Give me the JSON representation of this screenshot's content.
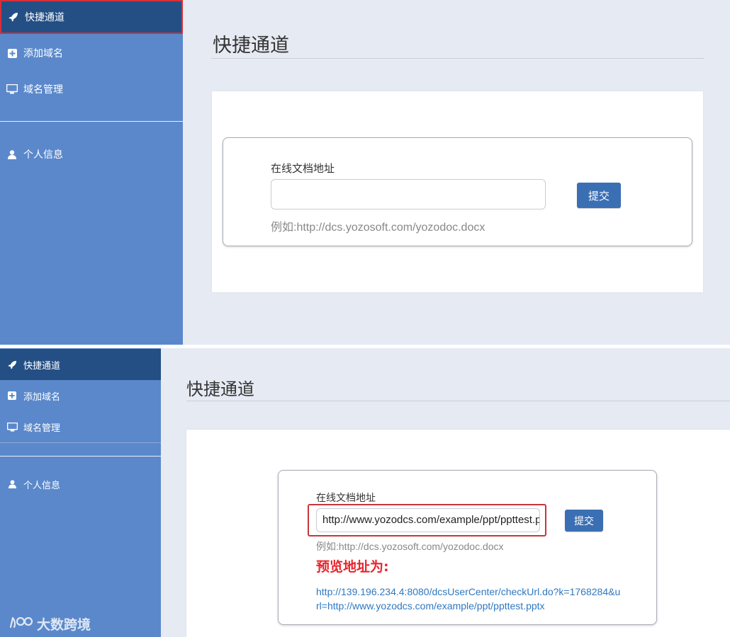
{
  "sidebar": {
    "items": [
      {
        "label": "快捷通道",
        "icon": "rocket-icon"
      },
      {
        "label": "添加域名",
        "icon": "plus-square-icon"
      },
      {
        "label": "域名管理",
        "icon": "monitor-icon"
      },
      {
        "label": "个人信息",
        "icon": "user-icon"
      }
    ]
  },
  "main": {
    "title": "快捷通道",
    "field_label": "在线文档地址",
    "hint": "例如:http://dcs.yozosoft.com/yozodoc.docx",
    "submit_label": "提交"
  },
  "step1": {
    "input_value": ""
  },
  "step2": {
    "input_value": "http://www.yozodcs.com/example/ppt/ppttest.pptx",
    "preview_title": "预览地址为:",
    "preview_url": "http://139.196.234.4:8080/dcsUserCenter/checkUrl.do?k=1768284&url=http://www.yozodcs.com/example/ppt/ppttest.pptx"
  },
  "watermark": {
    "text": "大数跨境",
    "icon": "logo-icon"
  },
  "colors": {
    "sidebar": "#5b88cb",
    "sidebar_active": "#234f85",
    "button": "#3b6fb3",
    "highlight_outline": "#c8353b",
    "preview_title": "#e8242c",
    "link": "#2f78c0"
  }
}
